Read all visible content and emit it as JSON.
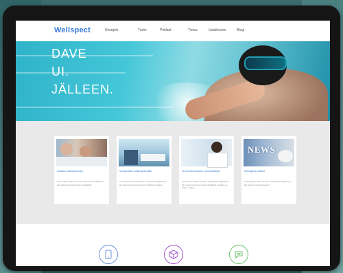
{
  "nav": {
    "logo": "Wellspect",
    "items": [
      "Kirurgisk",
      "Tuote",
      "Potilaat",
      "Tietoa",
      "Uutishuone",
      "Blogi"
    ]
  },
  "hero": {
    "line1": "DAVE",
    "line2": "UI.",
    "line3": "JÄLLEEN."
  },
  "cards": [
    {
      "title": "Laadun tarkistaminen",
      "text": "Lorem ipsum dolor sit amet, consectetur adipiscing elit, sed do eiusmod tempor incididunt."
    },
    {
      "title": "Virtsarakon hallinta tänään",
      "text": "Lorem ipsum dolor sit amet, consectetur adipiscing elit, sed do eiusmod tempor incididunt ut labore."
    },
    {
      "title": "Terveydenhuollon ammattilaiset",
      "text": "Lorem ipsum dolor sit amet, consectetur adipiscing elit, sed do eiusmod tempor incididunt ut labore et dolore magna."
    },
    {
      "title": "Wellspect-uutiset",
      "text": "Lorem ipsum dolor sit amet, consectetur adipiscing elit, sed do eiusmod tempor."
    }
  ],
  "card_images": {
    "news_word": "NEWS"
  },
  "icons": [
    {
      "name": "tablet-icon",
      "color": "#6a8fd6"
    },
    {
      "name": "box-icon",
      "color": "#a24ec9"
    },
    {
      "name": "chat-icon",
      "color": "#6ac46a"
    }
  ],
  "colors": {
    "accent": "#3a7bd5",
    "hero": "#2fb3c9",
    "section_bg": "#e9e9e9"
  }
}
